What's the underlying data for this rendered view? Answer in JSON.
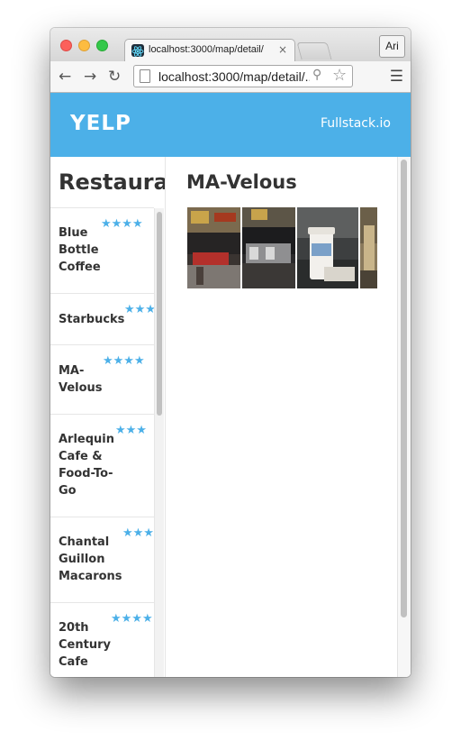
{
  "browser": {
    "tab_title": "localhost:3000/map/detail/",
    "tab_close": "×",
    "profile": "Ari",
    "url": "localhost:3000/map/detail/...",
    "nav": {
      "back": "←",
      "forward": "→",
      "reload": "↻",
      "zoom": "⚲",
      "star": "☆",
      "menu": "☰"
    }
  },
  "header": {
    "logo": "YELP",
    "link": "Fullstack.io"
  },
  "sidebar": {
    "title": "Restaurants",
    "items": [
      {
        "name": "Blue\nBottle\nCoffee",
        "stars": "★★★★"
      },
      {
        "name": "Starbucks",
        "stars": "★★★"
      },
      {
        "name": "MA-\nVelous",
        "stars": "★★★★"
      },
      {
        "name": "Arlequin\nCafe &\nFood-To-\nGo",
        "stars": "★★★"
      },
      {
        "name": "Chantal\nGuillon\nMacarons",
        "stars": "★★★"
      },
      {
        "name": "20th\nCentury\nCafe",
        "stars": "★★★★"
      }
    ]
  },
  "detail": {
    "title": "MA-Velous"
  },
  "colors": {
    "accent": "#4cb0e8",
    "header_bg": "#4cb0e8",
    "text": "#333333"
  }
}
